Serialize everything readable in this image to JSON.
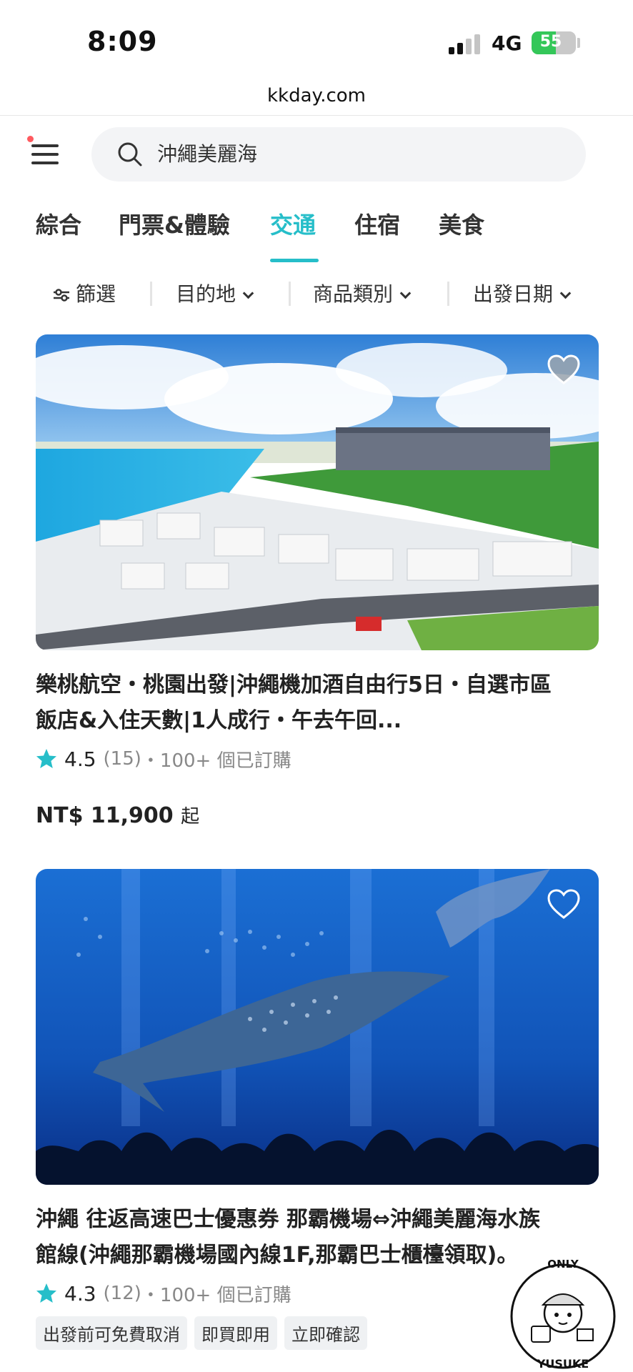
{
  "status_bar": {
    "time": "8:09",
    "network": "4G",
    "battery": "55",
    "battery_level": 0.55
  },
  "browser": {
    "url": "kkday.com"
  },
  "search": {
    "value": "沖繩美麗海"
  },
  "tabs": [
    {
      "label": "綜合"
    },
    {
      "label": "門票&體驗"
    },
    {
      "label": "交通",
      "active": true
    },
    {
      "label": "住宿"
    },
    {
      "label": "美食"
    }
  ],
  "filters": [
    {
      "label": "篩選",
      "icon": "sliders-icon"
    },
    {
      "label": "目的地",
      "icon": "chevron-down-icon"
    },
    {
      "label": "商品類別",
      "icon": "chevron-down-icon"
    },
    {
      "label": "出發日期",
      "icon": "chevron-down-icon"
    }
  ],
  "products": [
    {
      "title_line1": "樂桃航空・桃園出發|沖繩機加酒自由行5日・自選市區",
      "title_line2": "飯店&入住天數|1人成行・午去午回...",
      "rating": "4.5",
      "reviews": "(15)",
      "booked": "・100+ 個已訂購",
      "price": "NT$ 11,900",
      "price_suffix": "起",
      "image": "okinawa-resort-aerial-photo"
    },
    {
      "title_line1": "沖繩 往返高速巴士優惠券 那霸機場⇔沖繩美麗海水族",
      "title_line2": "館線(沖繩那霸機場國內線1F,那霸巴士櫃檯領取)。",
      "rating": "4.3",
      "reviews": "(12)",
      "booked": "・100+ 個已訂購",
      "tags": [
        "出發前可免費取消",
        "即買即用",
        "立即確認"
      ],
      "image": "aquarium-whale-shark-photo"
    }
  ],
  "watermark": {
    "text_top": "O N L Y",
    "text_bottom": "YUSUKE"
  },
  "colors": {
    "accent": "#26bec9",
    "star": "#26bec9",
    "battery": "#34c759"
  }
}
